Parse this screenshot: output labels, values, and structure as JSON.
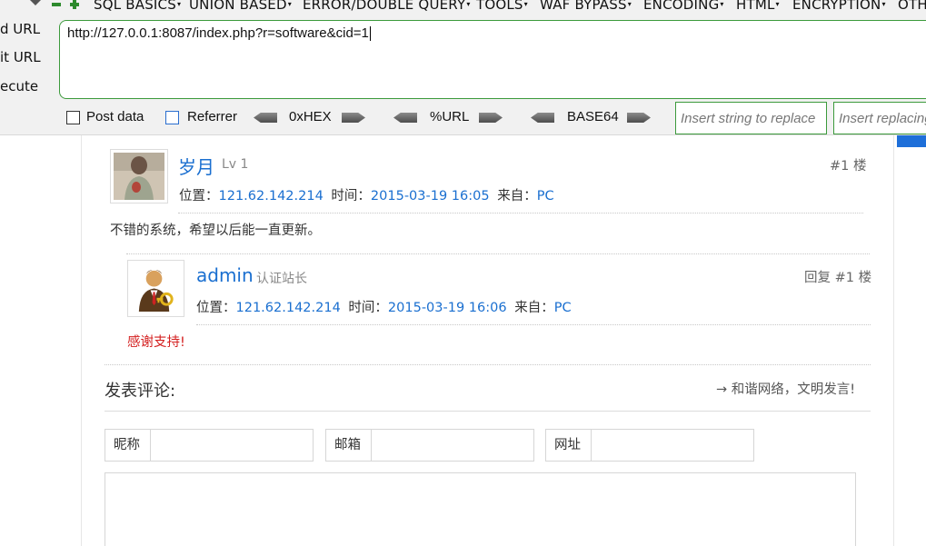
{
  "hackbar": {
    "menu": [
      "SQL BASICS",
      "UNION BASED",
      "ERROR/DOUBLE QUERY",
      "TOOLS",
      "WAF BYPASS",
      "ENCODING",
      "HTML",
      "ENCRYPTION",
      "OTH"
    ],
    "side_labels": {
      "load": "d URL",
      "split": "it URL",
      "execute": "ecute"
    },
    "url": "http://127.0.0.1:8087/index.php?r=software&cid=1",
    "checkboxes": {
      "post_data": "Post data",
      "referrer": "Referrer"
    },
    "encoders": [
      "0xHEX",
      "%URL",
      "BASE64"
    ],
    "replace_placeholder": "Insert string to replace",
    "replacing_placeholder": "Insert replacing string"
  },
  "colors": {
    "accent_green": "#3c9a3c",
    "link_blue": "#1a6fd0",
    "reply_red": "#d42020",
    "tab_blue": "#1e6fd9"
  },
  "comments": [
    {
      "name": "岁月",
      "level": "Lv 1",
      "floor": "#1 楼",
      "location_label": "位置：",
      "ip": "121.62.142.214",
      "time_label": "时间：",
      "time": "2015-03-19 16:05",
      "from_label": "来自：",
      "from": "PC",
      "text": "不错的系统，希望以后能一直更新。"
    }
  ],
  "reply": {
    "name": "admin",
    "level": "认证站长",
    "floor": "回复 #1 楼",
    "location_label": "位置：",
    "ip": "121.62.142.214",
    "time_label": "时间：",
    "time": "2015-03-19 16:06",
    "from_label": "来自：",
    "from": "PC",
    "text": "感谢支持!"
  },
  "form": {
    "title": "发表评论:",
    "hint": "→ 和谐网络，文明发言!",
    "fields": {
      "nickname": "昵称",
      "email": "邮箱",
      "website": "网址"
    }
  }
}
